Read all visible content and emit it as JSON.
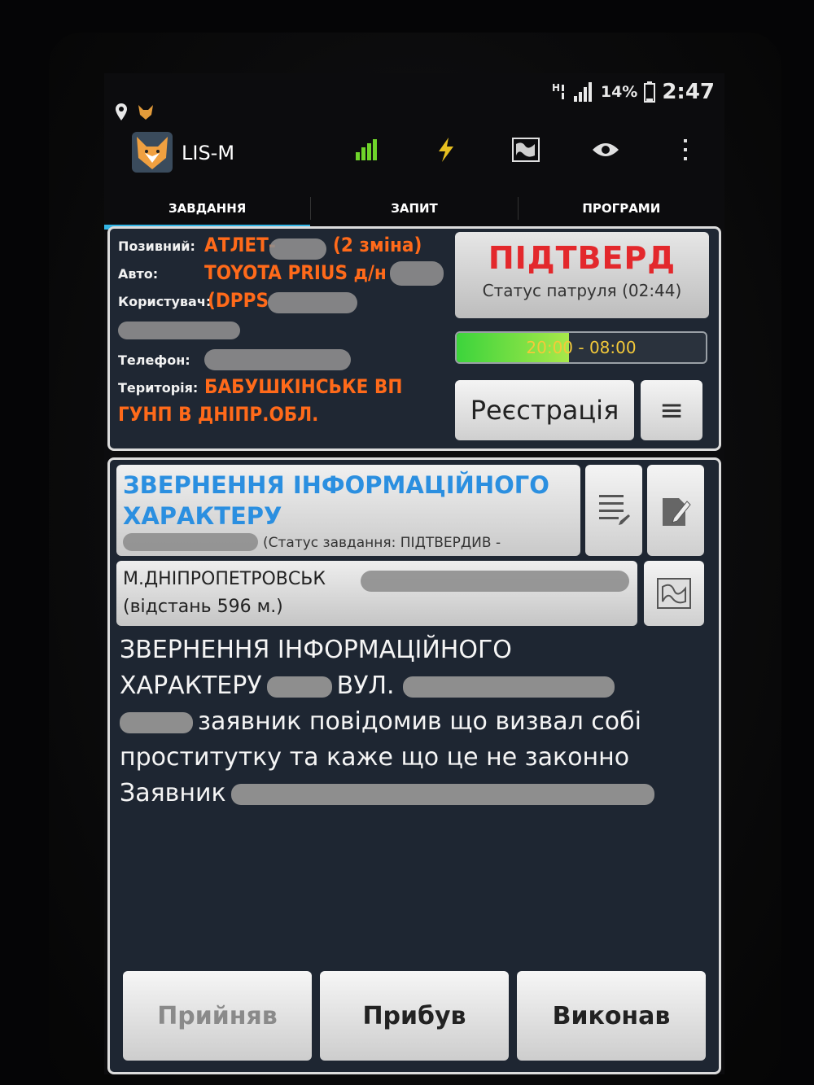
{
  "status_bar": {
    "battery": "14%",
    "time": "2:47"
  },
  "action_bar": {
    "app_title": "LIS-M"
  },
  "tabs": [
    {
      "label": "ЗАВДАННЯ",
      "active": true
    },
    {
      "label": "ЗАПИТ",
      "active": false
    },
    {
      "label": "ПРОГРАМИ",
      "active": false
    }
  ],
  "patrol": {
    "callsign_label": "Позивний:",
    "callsign_value": "АТЛЕТ-",
    "callsign_shift": "(2 зміна)",
    "auto_label": "Авто:",
    "auto_value": "TOYOTA PRIUS д/н",
    "user_label": "Користувач:",
    "user_value": "(DPPS",
    "phone_label": "Телефон:",
    "territory_label": "Територія:",
    "territory_value_1": "БАБУШКІНСЬКЕ ВП",
    "territory_value_2": "ГУНП В ДНІПР.ОБЛ."
  },
  "status_panel": {
    "confirm_title": "ПІДТВЕРД",
    "patrol_status": "Статус патруля (02:44)",
    "shift_label": "20:00 - 08:00",
    "shift_progress": 0.45,
    "register_button": "Реєстрація",
    "menu_icon": "≡"
  },
  "task": {
    "title": "ЗВЕРНЕННЯ ІНФОРМАЦІЙНОГО ХАРАКТЕРУ",
    "status": "(Статус завдання: ПІДТВЕРДИВ -",
    "city": "М.ДНІПРОПЕТРОВСЬК",
    "distance": "(відстань 596 м.)",
    "description_1": "ЗВЕРНЕННЯ ІНФОРМАЦІЙНОГО",
    "description_2a": "ХАРАКТЕРУ",
    "description_2b": "ВУЛ.",
    "description_3": "заявник повідомив що визвал собі",
    "description_4": "проститутку та каже що це не законно",
    "description_5": "Заявник"
  },
  "actions": {
    "accepted": "Прийняв",
    "arrived": "Прибув",
    "done": "Виконав"
  },
  "colors": {
    "accent": "#33b5e5",
    "orange": "#ff6a1a",
    "confirm_red": "#e3282c",
    "task_blue": "#2b8fe0"
  }
}
